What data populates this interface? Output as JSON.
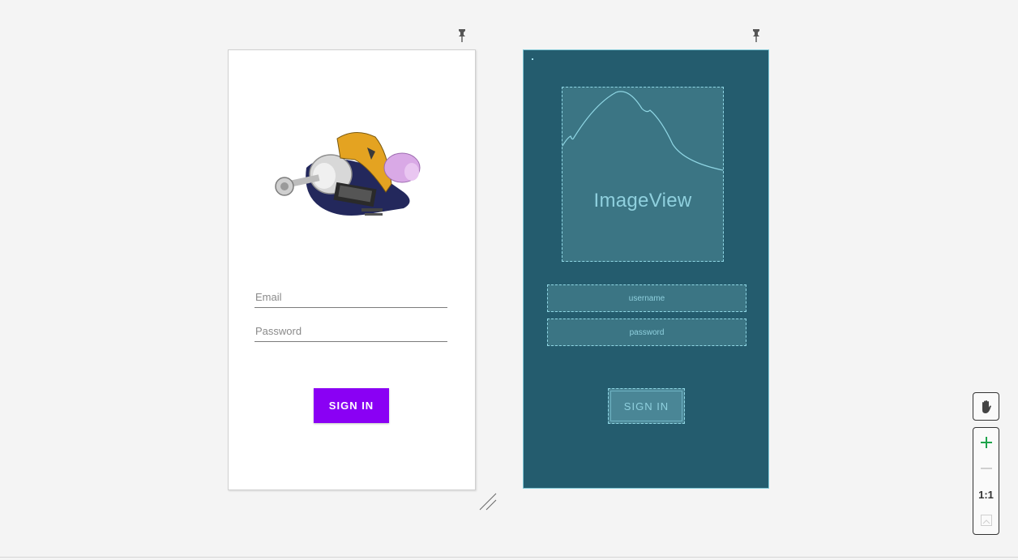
{
  "design_screen": {
    "email_placeholder": "Email",
    "password_placeholder": "Password",
    "signin_label": "SIGN IN",
    "signin_color": "#8a00f4"
  },
  "blueprint_screen": {
    "image_label": "ImageView",
    "username_label": "username",
    "password_label": "password",
    "signin_label": "SIGN IN",
    "background_color": "#245c6e"
  },
  "toolbar": {
    "pan_icon": "hand-icon",
    "zoom_in_icon": "plus-icon",
    "zoom_out_icon": "minus-icon",
    "zoom_reset_label": "1:1",
    "zoom_fit_icon": "fit-screen-icon"
  }
}
